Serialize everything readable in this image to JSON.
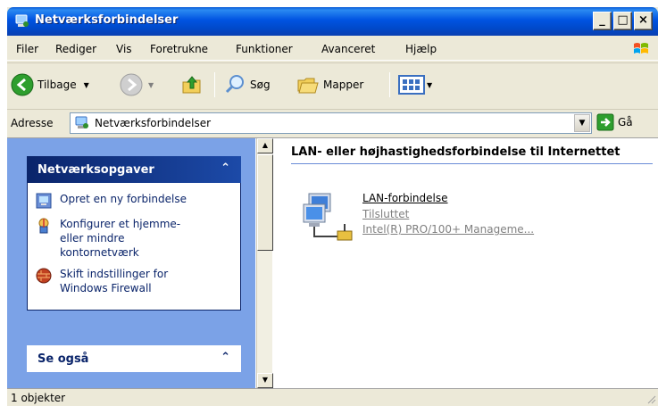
{
  "window": {
    "title": "Netværksforbindelser",
    "buttons": {
      "minimize": "_",
      "maximize": "□",
      "close": "×"
    }
  },
  "menu": [
    "Filer",
    "Rediger",
    "Vis",
    "Foretrukne",
    "Funktioner",
    "Avanceret",
    "Hjælp"
  ],
  "toolbar": {
    "back": "Tilbage",
    "search": "Søg",
    "folders": "Mapper"
  },
  "address": {
    "label": "Adresse",
    "value": "Netværksforbindelser",
    "go": "Gå"
  },
  "left_pane": {
    "network_tasks": {
      "title": "Netværksopgaver",
      "items": [
        {
          "label": "Opret en ny forbindelse",
          "icon": "new-connection-icon"
        },
        {
          "label": "Konfigurer et hjemme-\neller mindre\nkontornetværk",
          "icon": "home-network-wizard-icon"
        },
        {
          "label": "Skift indstillinger for\nWindows Firewall",
          "icon": "firewall-icon"
        }
      ]
    },
    "see_also": {
      "title": "Se også"
    }
  },
  "right_pane": {
    "group_header": "LAN- eller højhastighedsforbindelse til Internettet",
    "connection": {
      "name": "LAN-forbindelse",
      "status": "Tilsluttet",
      "device": "Intel(R) PRO/100+ Manageme..."
    }
  },
  "status_bar": {
    "text": "1 objekter"
  },
  "colors": {
    "titlebar": "#0053e1",
    "panel_header": "#0a246a",
    "left_pane_bg": "#7ba2e7",
    "chrome": "#ece9d8"
  }
}
